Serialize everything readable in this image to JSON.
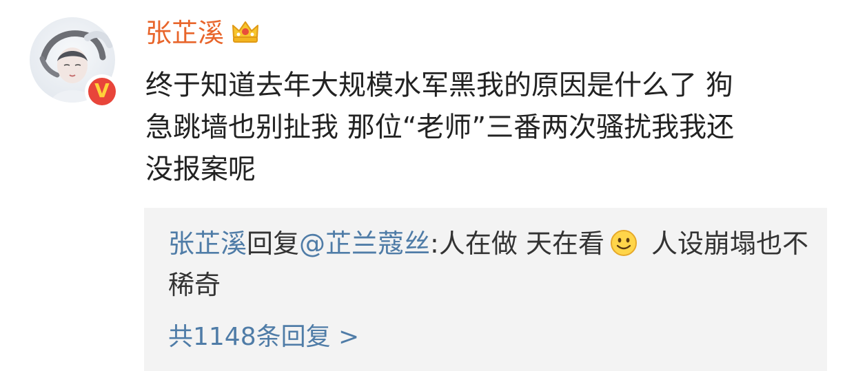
{
  "user": {
    "name": "张芷溪",
    "crown_icon": "crown-icon",
    "verified_icon": "verified-v-icon",
    "verified_label": "V"
  },
  "post": {
    "text": "终于知道去年大规模水军黑我的原因是什么了 狗\n急跳墙也别扯我 那位“老师”三番两次骚扰我我还\n没报案呢"
  },
  "reply": {
    "author": "张芷溪",
    "action": "回复",
    "mention": "@芷兰蔻丝",
    "colon": ":",
    "text_before_emoji": "人在做 天在看",
    "emoji": "smiley-icon",
    "text_after_emoji": "人设崩塌也不稀奇",
    "count_label": "共1148条回复 >"
  },
  "colors": {
    "username": "#e8652b",
    "link_blue": "#4f7ca7",
    "reply_bg": "#f3f3f3",
    "badge_red": "#e8453a",
    "badge_yellow": "#ffd23a"
  }
}
